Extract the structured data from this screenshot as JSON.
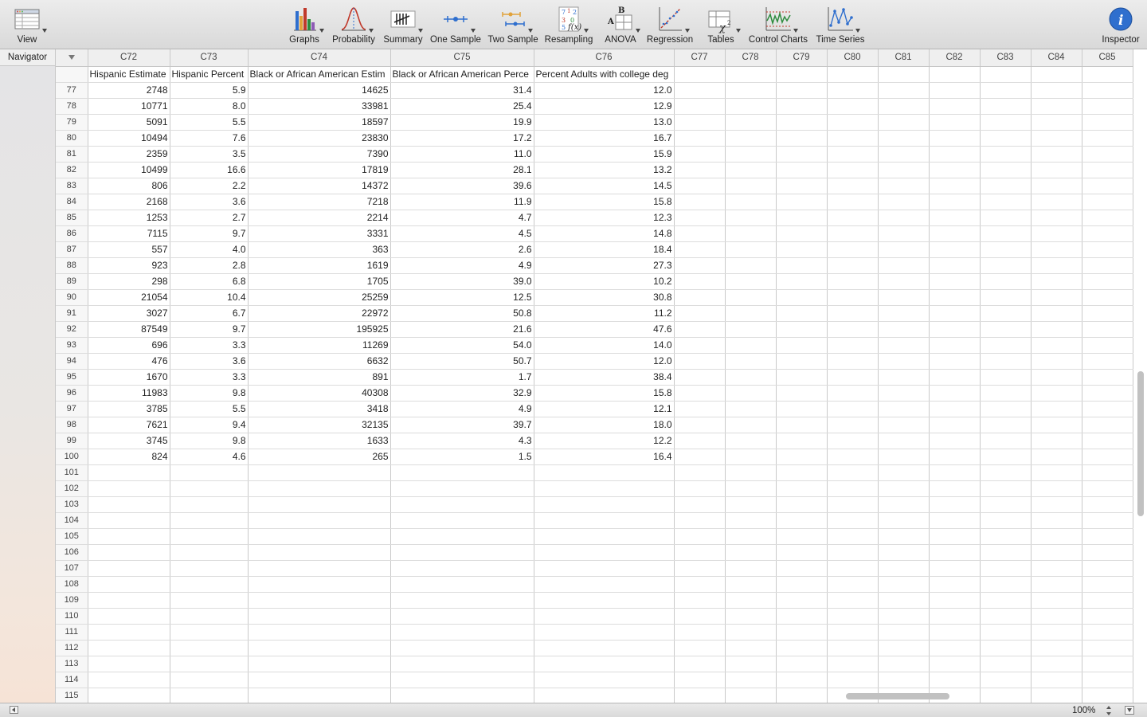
{
  "toolbar": {
    "view_label": "View",
    "items": [
      {
        "label": "Graphs",
        "icon": "bar-chart-icon"
      },
      {
        "label": "Probability",
        "icon": "normal-curve-icon"
      },
      {
        "label": "Summary",
        "icon": "tally-icon"
      },
      {
        "label": "One Sample",
        "icon": "one-sample-icon"
      },
      {
        "label": "Two Sample",
        "icon": "two-sample-icon"
      },
      {
        "label": "Resampling",
        "icon": "resampling-icon"
      },
      {
        "label": "ANOVA",
        "icon": "anova-icon"
      },
      {
        "label": "Regression",
        "icon": "regression-icon"
      },
      {
        "label": "Tables",
        "icon": "chi-square-icon"
      },
      {
        "label": "Control Charts",
        "icon": "control-chart-icon"
      },
      {
        "label": "Time Series",
        "icon": "time-series-icon"
      }
    ],
    "inspector_label": "Inspector",
    "colors": {
      "accent_blue": "#2f6fce",
      "graph_red": "#c0392b",
      "graph_green": "#2e8b3e"
    }
  },
  "navigator": {
    "label": "Navigator"
  },
  "sheet": {
    "columns": [
      "C72",
      "C73",
      "C74",
      "C75",
      "C76",
      "C77",
      "C78",
      "C79",
      "C80",
      "C81",
      "C82",
      "C83",
      "C84",
      "C85"
    ],
    "column_names": [
      "Hispanic Estimate",
      "Hispanic Percent",
      "Black or African American Estim",
      "Black or African American Perce",
      "Percent Adults with college deg",
      "",
      "",
      "",
      "",
      "",
      "",
      "",
      "",
      ""
    ],
    "rows": [
      {
        "n": "77",
        "v": [
          "2748",
          "5.9",
          "14625",
          "31.4",
          "12.0"
        ]
      },
      {
        "n": "78",
        "v": [
          "10771",
          "8.0",
          "33981",
          "25.4",
          "12.9"
        ]
      },
      {
        "n": "79",
        "v": [
          "5091",
          "5.5",
          "18597",
          "19.9",
          "13.0"
        ]
      },
      {
        "n": "80",
        "v": [
          "10494",
          "7.6",
          "23830",
          "17.2",
          "16.7"
        ]
      },
      {
        "n": "81",
        "v": [
          "2359",
          "3.5",
          "7390",
          "11.0",
          "15.9"
        ]
      },
      {
        "n": "82",
        "v": [
          "10499",
          "16.6",
          "17819",
          "28.1",
          "13.2"
        ]
      },
      {
        "n": "83",
        "v": [
          "806",
          "2.2",
          "14372",
          "39.6",
          "14.5"
        ]
      },
      {
        "n": "84",
        "v": [
          "2168",
          "3.6",
          "7218",
          "11.9",
          "15.8"
        ]
      },
      {
        "n": "85",
        "v": [
          "1253",
          "2.7",
          "2214",
          "4.7",
          "12.3"
        ]
      },
      {
        "n": "86",
        "v": [
          "7115",
          "9.7",
          "3331",
          "4.5",
          "14.8"
        ]
      },
      {
        "n": "87",
        "v": [
          "557",
          "4.0",
          "363",
          "2.6",
          "18.4"
        ]
      },
      {
        "n": "88",
        "v": [
          "923",
          "2.8",
          "1619",
          "4.9",
          "27.3"
        ]
      },
      {
        "n": "89",
        "v": [
          "298",
          "6.8",
          "1705",
          "39.0",
          "10.2"
        ]
      },
      {
        "n": "90",
        "v": [
          "21054",
          "10.4",
          "25259",
          "12.5",
          "30.8"
        ]
      },
      {
        "n": "91",
        "v": [
          "3027",
          "6.7",
          "22972",
          "50.8",
          "11.2"
        ]
      },
      {
        "n": "92",
        "v": [
          "87549",
          "9.7",
          "195925",
          "21.6",
          "47.6"
        ]
      },
      {
        "n": "93",
        "v": [
          "696",
          "3.3",
          "11269",
          "54.0",
          "14.0"
        ]
      },
      {
        "n": "94",
        "v": [
          "476",
          "3.6",
          "6632",
          "50.7",
          "12.0"
        ]
      },
      {
        "n": "95",
        "v": [
          "1670",
          "3.3",
          "891",
          "1.7",
          "38.4"
        ]
      },
      {
        "n": "96",
        "v": [
          "11983",
          "9.8",
          "40308",
          "32.9",
          "15.8"
        ]
      },
      {
        "n": "97",
        "v": [
          "3785",
          "5.5",
          "3418",
          "4.9",
          "12.1"
        ]
      },
      {
        "n": "98",
        "v": [
          "7621",
          "9.4",
          "32135",
          "39.7",
          "18.0"
        ]
      },
      {
        "n": "99",
        "v": [
          "3745",
          "9.8",
          "1633",
          "4.3",
          "12.2"
        ]
      },
      {
        "n": "100",
        "v": [
          "824",
          "4.6",
          "265",
          "1.5",
          "16.4"
        ]
      },
      {
        "n": "101",
        "v": []
      },
      {
        "n": "102",
        "v": []
      },
      {
        "n": "103",
        "v": []
      },
      {
        "n": "104",
        "v": []
      },
      {
        "n": "105",
        "v": []
      },
      {
        "n": "106",
        "v": []
      },
      {
        "n": "107",
        "v": []
      },
      {
        "n": "108",
        "v": []
      },
      {
        "n": "109",
        "v": []
      },
      {
        "n": "110",
        "v": []
      },
      {
        "n": "111",
        "v": []
      },
      {
        "n": "112",
        "v": []
      },
      {
        "n": "113",
        "v": []
      },
      {
        "n": "114",
        "v": []
      },
      {
        "n": "115",
        "v": []
      }
    ]
  },
  "statusbar": {
    "zoom": "100%"
  }
}
